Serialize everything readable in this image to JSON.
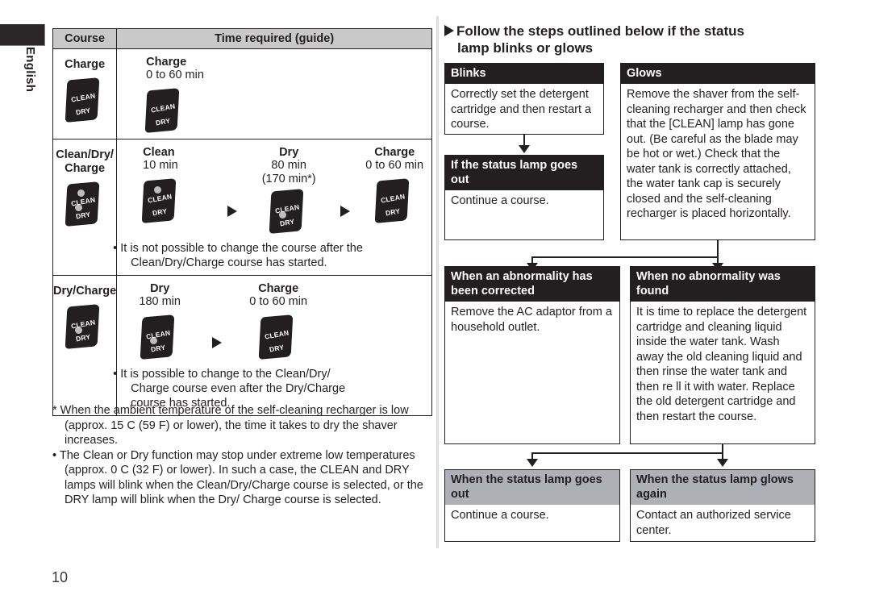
{
  "language_tab": {
    "label": "English"
  },
  "page_number": "10",
  "course_table": {
    "headers": [
      "Course",
      "Time required (guide)"
    ],
    "rows": [
      {
        "course": "Charge",
        "course_icon": "lamp-panel-no-dots",
        "stages": [
          {
            "title": "Charge",
            "time": "0 to 60 min",
            "icon": "lamp-panel-no-dots"
          }
        ],
        "note": ""
      },
      {
        "course_line1": "Clean/Dry/",
        "course_line2": "Charge",
        "course_icon": "lamp-panel-both-dots",
        "stages": [
          {
            "title": "Clean",
            "time": "10 min",
            "icon": "lamp-panel-clean-dot"
          },
          {
            "title": "Dry",
            "time": "80 min",
            "time2": "(170 min*)",
            "icon": "lamp-panel-dry-dot"
          },
          {
            "title": "Charge",
            "time": "0 to 60 min",
            "icon": "lamp-panel-no-dots"
          }
        ],
        "note_line1": "It is not possible to change the course after the",
        "note_line2": "Clean/Dry/Charge  course has started."
      },
      {
        "course": "Dry/Charge",
        "course_icon": "lamp-panel-dry-dot",
        "stages": [
          {
            "title": "Dry",
            "time": "180 min",
            "icon": "lamp-panel-dry-dot"
          },
          {
            "title": "Charge",
            "time": "0 to 60 min",
            "icon": "lamp-panel-no-dots"
          }
        ],
        "note_line1": "It is possible to change to the  Clean/Dry/",
        "note_line2": "Charge  course even after the  Dry/Charge",
        "note_line3": "course has started."
      }
    ]
  },
  "footnotes": {
    "asterisk_note": "* When the ambient temperature of the self-cleaning recharger is low (approx. 15  C (59  F) or lower), the time it takes to dry the shaver increases.",
    "bullet_note": "• The Clean or Dry function may stop under extreme low temperatures (approx. 0  C (32  F) or lower). In such a case, the CLEAN and DRY lamps will blink when the  Clean/Dry/Charge  course is selected, or the DRY lamp will blink when the  Dry/ Charge  course is selected."
  },
  "right": {
    "heading_line1": "Follow the steps outlined below if the status",
    "heading_line2": "lamp blinks or glows",
    "boxes": {
      "blinks": {
        "header": "Blinks",
        "body": "Correctly set the detergent cartridge and then restart a course."
      },
      "status_lamp_goes_out": {
        "header": "If the status lamp goes out",
        "body": "Continue a course."
      },
      "glows": {
        "header": "Glows",
        "body": "Remove the shaver from the self-cleaning recharger and then check that the [CLEAN] lamp has gone out. (Be careful as the blade may be hot or wet.) Check that the water tank is correctly attached, the water tank cap is securely closed and the self-cleaning recharger is placed horizontally."
      },
      "abnormality_corrected": {
        "header": "When an abnormality has been corrected",
        "body": "Remove the AC adaptor from a household outlet."
      },
      "no_abnormality_found": {
        "header": "When no abnormality was found",
        "body": "It is time to replace the detergent cartridge and cleaning liquid inside the water tank. Wash away the old cleaning liquid and then rinse the water tank and then re ll it with water. Replace the old detergent cartridge and then restart the course."
      },
      "lamp_goes_out": {
        "header": "When the status lamp goes out",
        "body": "Continue a course."
      },
      "lamp_glows_again": {
        "header": "When the status lamp glows again",
        "body": "Contact an authorized service center."
      }
    }
  },
  "colors": {
    "ink": "#231f20",
    "header_gray": "#c9c9c9",
    "box_gray": "#adb0b4",
    "lamp_dot": "#bdbdbd",
    "divider": "#dcdcdc"
  }
}
